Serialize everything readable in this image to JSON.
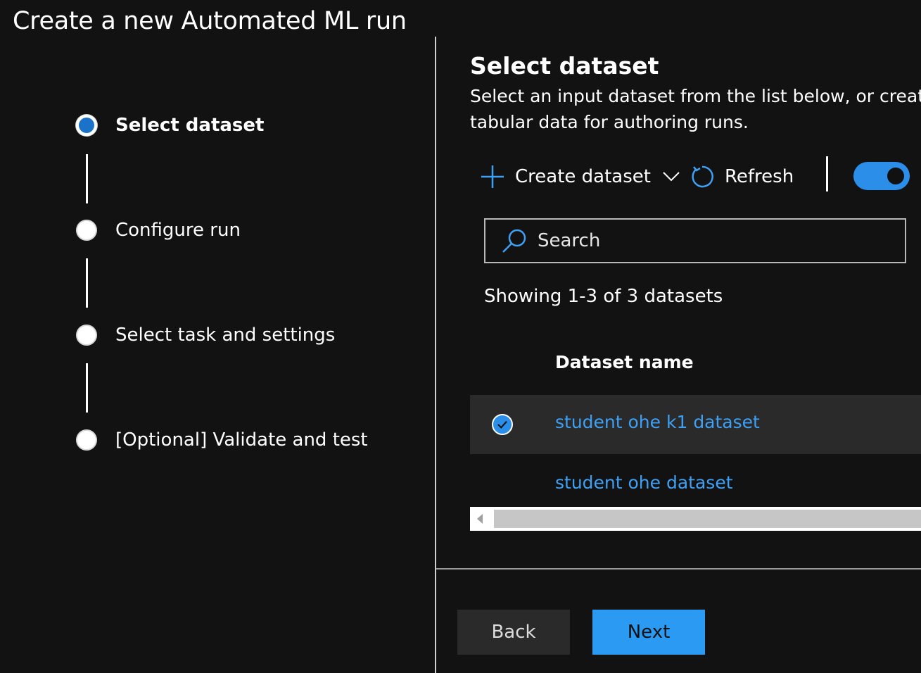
{
  "page": {
    "title": "Create a new Automated ML run"
  },
  "stepper": {
    "steps": [
      {
        "label": "Select dataset",
        "state": "active"
      },
      {
        "label": "Configure run",
        "state": "pending"
      },
      {
        "label": "Select task and settings",
        "state": "pending"
      },
      {
        "label": "[Optional] Validate and test",
        "state": "pending"
      }
    ]
  },
  "panel": {
    "title": "Select dataset",
    "description_line1": "Select an input dataset from the list below, or create",
    "description_line2": "tabular data for authoring runs."
  },
  "toolbar": {
    "create_label": "Create dataset",
    "refresh_label": "Refresh",
    "toggle_on": true
  },
  "search": {
    "placeholder": "Search",
    "value": ""
  },
  "list": {
    "showing_text": "Showing 1-3 of 3 datasets",
    "column_header": "Dataset name",
    "rows": [
      {
        "name": "student ohe k1 dataset",
        "selected": true
      },
      {
        "name": "student ohe dataset",
        "selected": false
      }
    ]
  },
  "footer": {
    "back_label": "Back",
    "next_label": "Next"
  },
  "colors": {
    "background": "#121212",
    "accent": "#2b9af3",
    "link": "#3ea0f5",
    "step_active": "#1a73c8"
  }
}
